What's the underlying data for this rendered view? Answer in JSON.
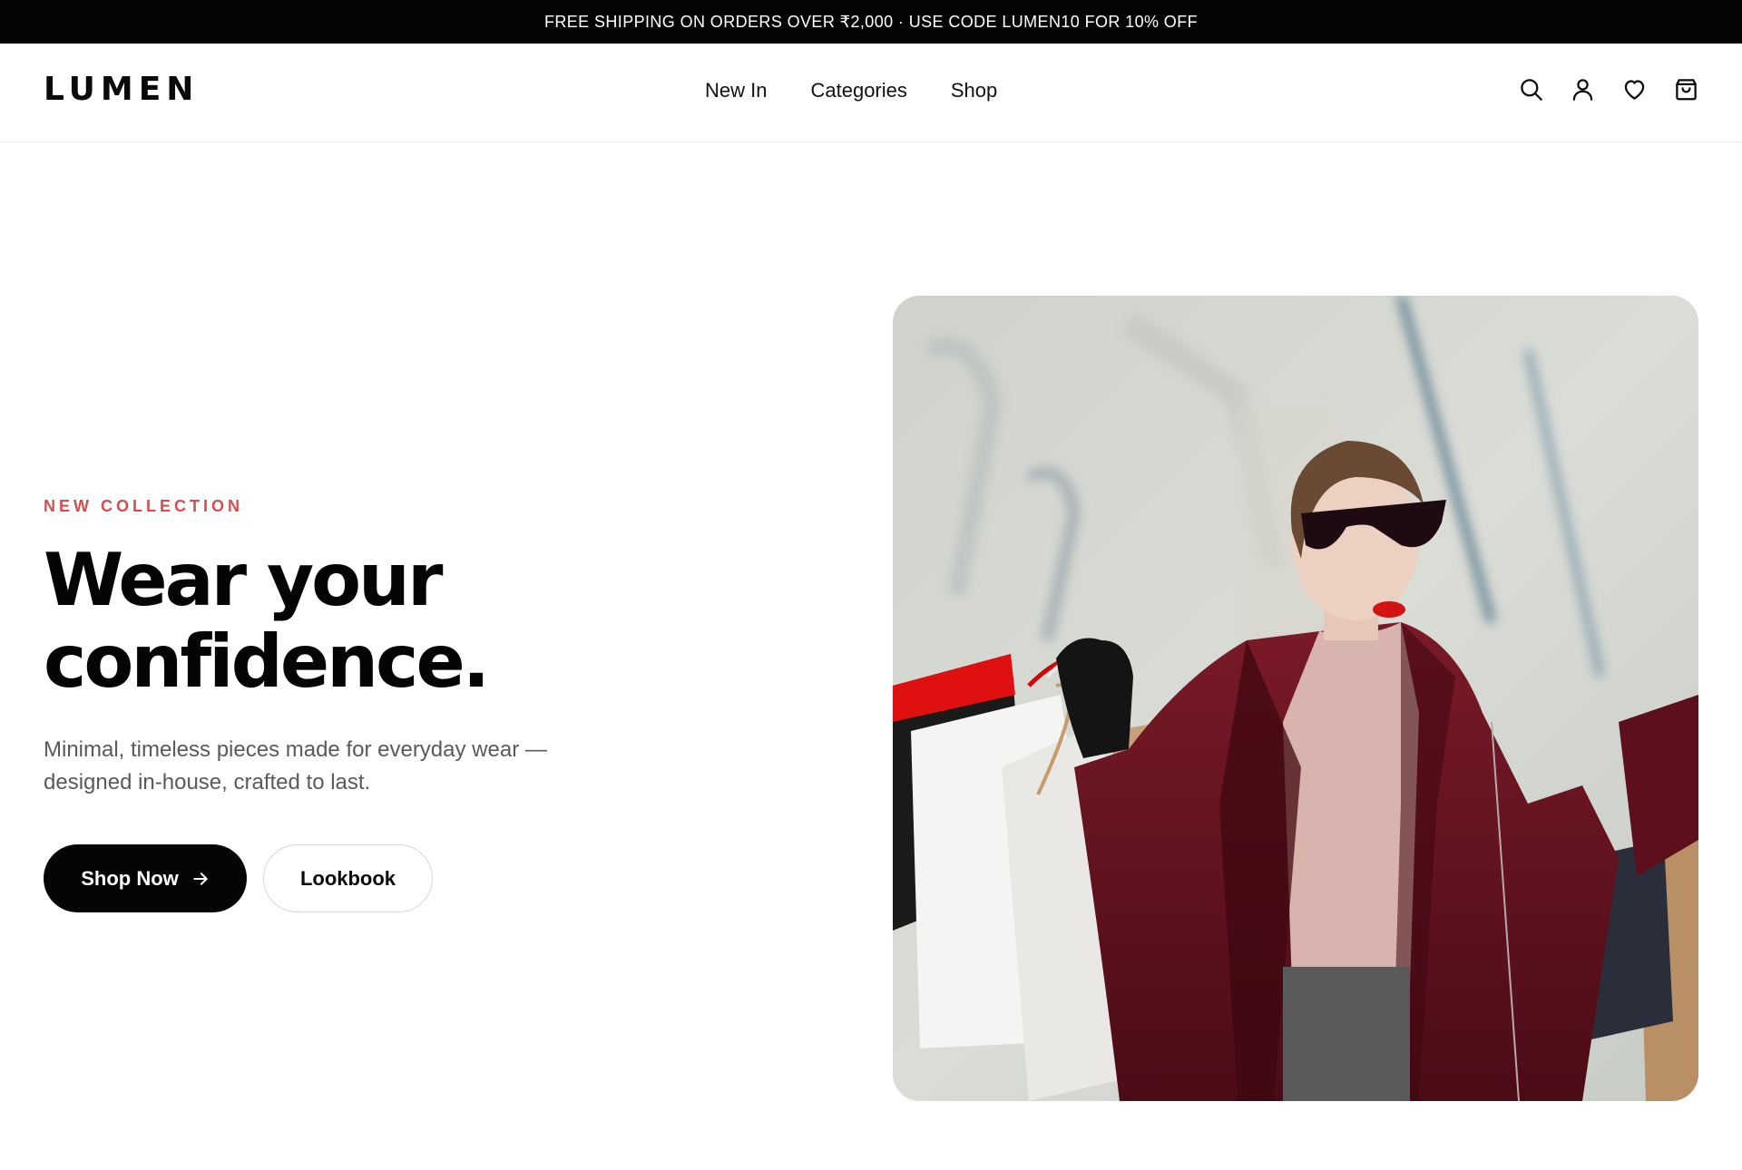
{
  "announcement": {
    "text": "FREE SHIPPING ON ORDERS OVER ₹2,000 · USE CODE LUMEN10 FOR 10% OFF"
  },
  "header": {
    "logo": "LUMEN",
    "nav": [
      {
        "label": "New In"
      },
      {
        "label": "Categories"
      },
      {
        "label": "Shop"
      }
    ],
    "icons": [
      "search-icon",
      "account-icon",
      "wishlist-icon",
      "cart-icon"
    ]
  },
  "hero": {
    "eyebrow": "NEW COLLECTION",
    "headline_line1": "Wear your",
    "headline_line2": "confidence.",
    "subtext": "Minimal, timeless pieces made for everyday wear — designed in-house, crafted to last.",
    "primary_cta": "Shop Now",
    "secondary_cta": "Lookbook",
    "image_subject": "woman in burgundy coat and sunglasses holding shopping bags"
  },
  "colors": {
    "announcement_bg": "#050505",
    "accent": "#d24f4f",
    "text": "#0a0a0a",
    "muted_text": "#5a5a5a",
    "coat": "#6e1522"
  }
}
